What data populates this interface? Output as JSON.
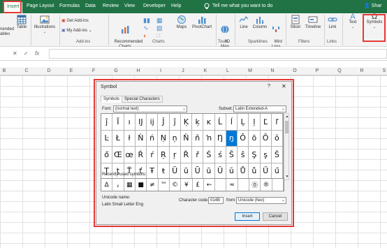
{
  "ribbon_tabs": [
    "Insert",
    "Page Layout",
    "Formulas",
    "Data",
    "Review",
    "View",
    "Developer",
    "Help"
  ],
  "tell_me": "Tell me what you want to do",
  "share": "Shar",
  "ribbon": {
    "recommended_tables_fragment": "nended\nables",
    "table": "Table",
    "illustrations": "Illustrations",
    "get_addins": "Get Add-ins",
    "my_addins": "My Add-ins",
    "addins_group": "Add-ins",
    "recommended_charts": "Recommended\nCharts",
    "maps": "Maps",
    "pivotchart": "PivotChart",
    "map3d": "3D\nMap",
    "charts_group": "Charts",
    "tours_group": "Tours",
    "line": "Line",
    "column": "Column",
    "winloss": "Win/\nLoss",
    "sparklines_group": "Sparklines",
    "slicer": "Slicer",
    "timeline": "Timeline",
    "filters_group": "Filters",
    "link": "Link",
    "links_group": "Links",
    "text": "Text",
    "symbols": "Symbols"
  },
  "formula_bar": {
    "cancel": "✕",
    "enter": "✓",
    "fx": "fx"
  },
  "columns": [
    "B",
    "C",
    "D",
    "E",
    "F",
    "G",
    "H",
    "I",
    "J",
    "K",
    "L",
    "M",
    "N",
    "O",
    "P",
    "Q",
    "R",
    "S"
  ],
  "dialog": {
    "title": "Symbol",
    "help": "?",
    "close": "✕",
    "tabs": [
      "Symbols",
      "Special Characters"
    ],
    "font_label": "Font:",
    "font_value": "(normal text)",
    "subset_label": "Subset:",
    "subset_value": "Latin Extended-A",
    "symbols": [
      "ĵ",
      "Ī",
      "ı",
      "Ĳ",
      "ĳ",
      "Ĵ",
      "ĵ",
      "Ķ",
      "ķ",
      "ĸ",
      "Ĺ",
      "ĺ",
      "Ļ",
      "ļ",
      "Ľ",
      "ľ",
      "Ŀ",
      "Ł",
      "ł",
      "Ń",
      "ń",
      "Ņ",
      "ņ",
      "Ň",
      "ň",
      "ŉ",
      "Ŋ",
      "ŋ",
      "Ō",
      "ō",
      "Ŏ",
      "ŏ",
      "ő",
      "Œ",
      "œ",
      "Ŕ",
      "ŕ",
      "Ŗ",
      "ŗ",
      "Ř",
      "ř",
      "Ś",
      "ś",
      "Ŝ",
      "ŝ",
      "Ş",
      "ş",
      "Š",
      "Ţ",
      "ţ",
      "Ť",
      "ť",
      "Ŧ",
      "ŧ",
      "Ũ",
      "ũ",
      "Ū",
      "ū",
      "Ŭ",
      "ŭ",
      "Ů",
      "ů",
      "Ű",
      "ű"
    ],
    "selected_symbol": "ŋ",
    "recent_label": "Recently used symbols:",
    "recent": [
      "Δ",
      "ﯾ",
      "▦",
      "■",
      "≠",
      "™",
      "©",
      "¥",
      "£",
      "←",
      "",
      "≈",
      "",
      "⓪",
      "®",
      ""
    ],
    "unicode_name_label": "Unicode name:",
    "unicode_name": "Latin Small Letter Eng",
    "char_code_label": "Character code:",
    "char_code": "014B",
    "from_label": "from:",
    "from_value": "Unicode (hex)",
    "insert": "Insert",
    "cancel": "Cancel"
  },
  "colors": {
    "ribbon_green": "#217346",
    "highlight": "#e53935",
    "selected": "#0078d7"
  }
}
